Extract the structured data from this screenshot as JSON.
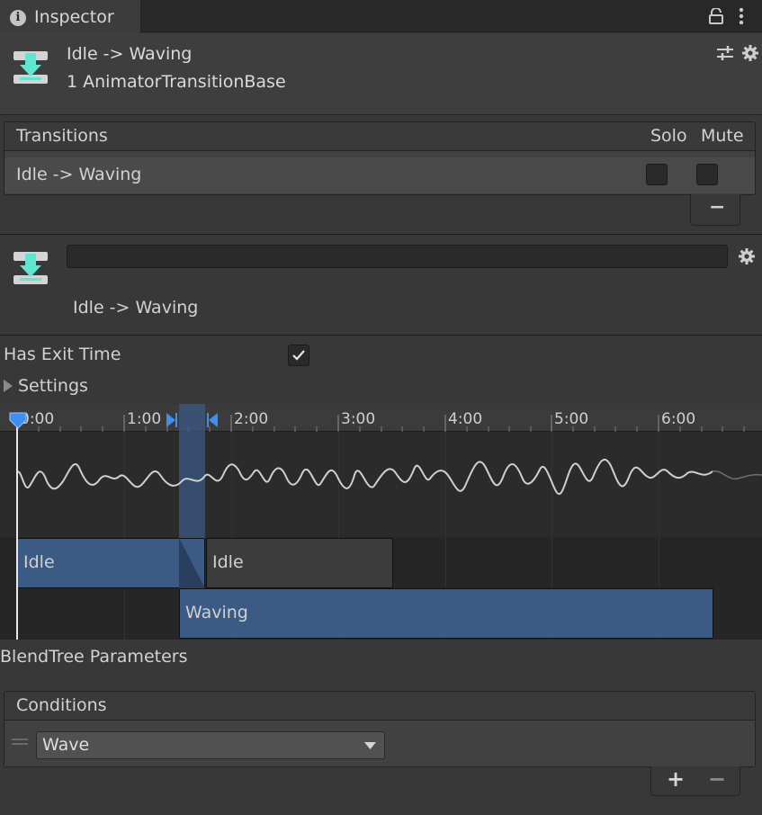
{
  "tab": {
    "title": "Inspector"
  },
  "header": {
    "title": "Idle -> Waving",
    "subtitle": "1 AnimatorTransitionBase"
  },
  "transitions": {
    "header": "Transitions",
    "solo_label": "Solo",
    "mute_label": "Mute",
    "items": [
      {
        "name": "Idle -> Waving",
        "solo": false,
        "mute": false
      }
    ],
    "remove_label": "−"
  },
  "transition": {
    "name_value": "",
    "label": "Idle -> Waving",
    "has_exit_time_label": "Has Exit Time",
    "has_exit_time": true,
    "settings_label": "Settings"
  },
  "timeline": {
    "ruler_labels": [
      "0:00",
      "1:00",
      "2:00",
      "3:00",
      "4:00",
      "5:00",
      "6:00"
    ],
    "clips": [
      {
        "label": "Idle"
      },
      {
        "label": "Idle"
      },
      {
        "label": "Waving"
      }
    ]
  },
  "blendtree": {
    "label": "BlendTree Parameters"
  },
  "conditions": {
    "header": "Conditions",
    "items": [
      {
        "parameter": "Wave"
      }
    ],
    "add_label": "+",
    "remove_label": "−"
  },
  "colors": {
    "accent_teal": "#5fe6d0",
    "clip_blue": "#3b5a84",
    "playhead_blue": "#3f8ff0"
  }
}
